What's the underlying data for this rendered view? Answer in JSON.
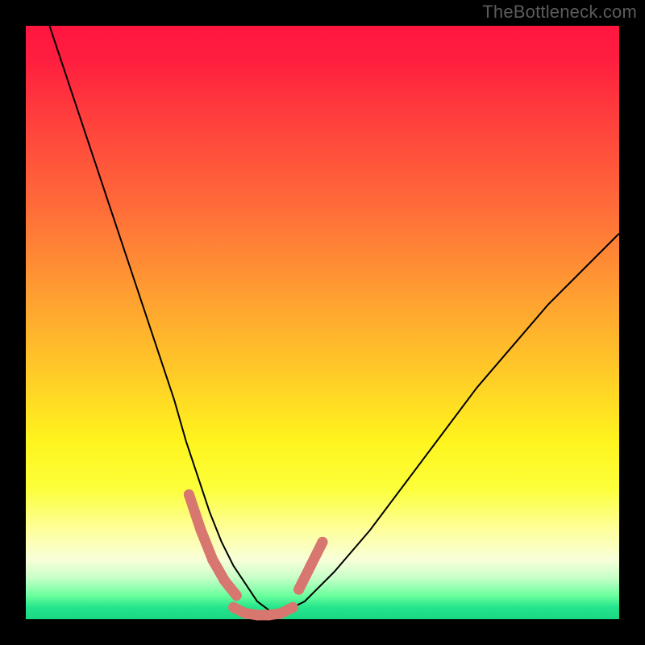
{
  "watermark": "TheBottleneck.com",
  "chart_data": {
    "type": "line",
    "title": "",
    "xlabel": "",
    "ylabel": "",
    "xlim": [
      0,
      100
    ],
    "ylim": [
      0,
      100
    ],
    "background": {
      "type": "vertical-gradient",
      "stops": [
        {
          "pos": 0,
          "color": "#ff153f"
        },
        {
          "pos": 14,
          "color": "#ff3a3d"
        },
        {
          "pos": 30,
          "color": "#ff6a39"
        },
        {
          "pos": 44,
          "color": "#ff9a32"
        },
        {
          "pos": 58,
          "color": "#ffc928"
        },
        {
          "pos": 70,
          "color": "#fff41e"
        },
        {
          "pos": 85,
          "color": "#feff9d"
        },
        {
          "pos": 93,
          "color": "#c8ffc9"
        },
        {
          "pos": 100,
          "color": "#1bd883"
        }
      ]
    },
    "series": [
      {
        "name": "bottleneck-curve",
        "color": "#000000",
        "width": 2,
        "x": [
          4,
          7,
          10,
          13,
          16,
          19,
          22,
          25,
          27,
          29,
          31,
          33,
          35,
          37,
          39,
          41,
          43,
          47,
          52,
          58,
          64,
          70,
          76,
          82,
          88,
          94,
          100
        ],
        "y": [
          100,
          91,
          82,
          73,
          64,
          55,
          46,
          37,
          30,
          24,
          18,
          13,
          9,
          6,
          3,
          1.5,
          1,
          3,
          8,
          15,
          23,
          31,
          39,
          46,
          53,
          59,
          65
        ]
      }
    ],
    "highlight_segments": [
      {
        "name": "left-salmon-segment",
        "color": "#d8776f",
        "width": 13,
        "x": [
          27.5,
          29.5,
          31.5,
          33.5,
          35.5
        ],
        "y": [
          21,
          15,
          10,
          6.5,
          4
        ]
      },
      {
        "name": "bottom-salmon-segment",
        "color": "#d8776f",
        "width": 13,
        "x": [
          35,
          37,
          39,
          41,
          43,
          45
        ],
        "y": [
          2.0,
          1.0,
          0.7,
          0.7,
          1.0,
          2.0
        ]
      },
      {
        "name": "right-salmon-segment",
        "color": "#d8776f",
        "width": 13,
        "x": [
          46,
          48,
          50
        ],
        "y": [
          5,
          9,
          13
        ]
      }
    ]
  }
}
